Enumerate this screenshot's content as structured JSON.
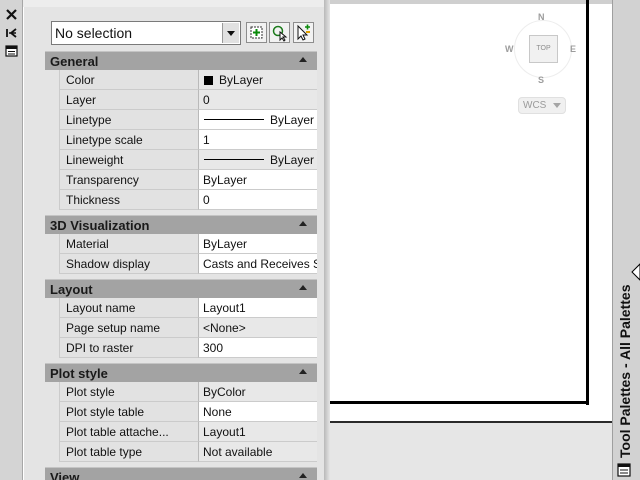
{
  "left_strip": {
    "icons": [
      "close-icon",
      "auto-hide-icon",
      "properties-menu-icon"
    ]
  },
  "properties_palette": {
    "selection_value": "No selection",
    "toolbar_icons": [
      "toggle-pickadd-icon",
      "select-objects-icon",
      "quick-select-icon"
    ],
    "sections": [
      {
        "title": "General",
        "rows": [
          {
            "name": "Color",
            "value": "ByLayer"
          },
          {
            "name": "Layer",
            "value": "0"
          },
          {
            "name": "Linetype",
            "value": "ByLayer"
          },
          {
            "name": "Linetype scale",
            "value": "1"
          },
          {
            "name": "Lineweight",
            "value": "ByLayer"
          },
          {
            "name": "Transparency",
            "value": "ByLayer"
          },
          {
            "name": "Thickness",
            "value": "0"
          }
        ]
      },
      {
        "title": "3D Visualization",
        "rows": [
          {
            "name": "Material",
            "value": "ByLayer"
          },
          {
            "name": "Shadow display",
            "value": "Casts and Receives S..."
          }
        ]
      },
      {
        "title": "Layout",
        "rows": [
          {
            "name": "Layout name",
            "value": "Layout1"
          },
          {
            "name": "Page setup name",
            "value": "<None>"
          },
          {
            "name": "DPI to raster",
            "value": "300"
          }
        ]
      },
      {
        "title": "Plot style",
        "rows": [
          {
            "name": "Plot style",
            "value": "ByColor"
          },
          {
            "name": "Plot style table",
            "value": "None"
          },
          {
            "name": "Plot table attache...",
            "value": "Layout1"
          },
          {
            "name": "Plot table type",
            "value": "Not available"
          }
        ]
      },
      {
        "title": "View",
        "rows": []
      }
    ]
  },
  "viewcube": {
    "north": "N",
    "west": "W",
    "east": "E",
    "south": "S",
    "top_face": "TOP",
    "wcs_label": "WCS"
  },
  "tool_palettes": {
    "title": "Tool Palettes - All Palettes"
  },
  "colors": {
    "section_header": "#a3a3a3",
    "palette_bg": "#e4e4e4",
    "paper": "#ffffff",
    "paper_border": "#000000"
  }
}
